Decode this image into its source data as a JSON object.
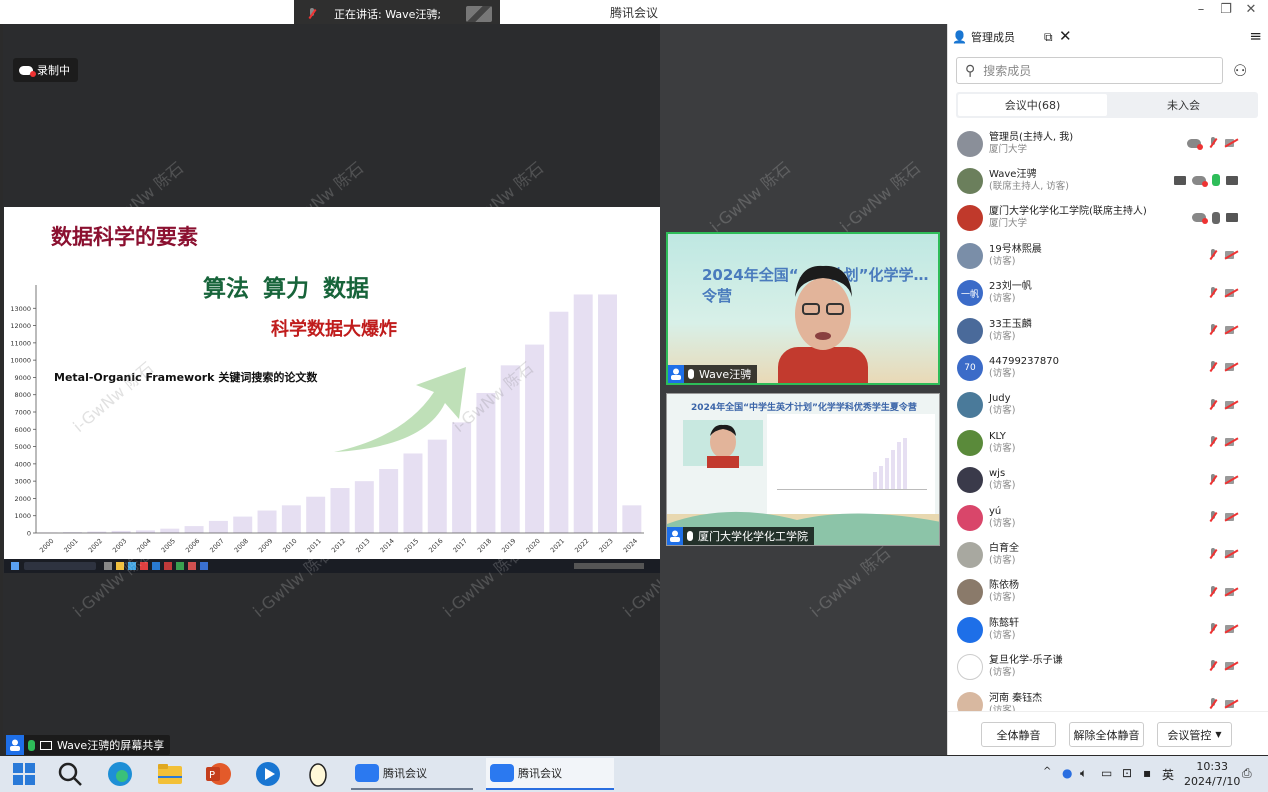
{
  "window": {
    "title": "腾讯会议"
  },
  "speaking": {
    "label": "正在讲话:  Wave汪骋;"
  },
  "recording": {
    "label": "录制中"
  },
  "watermark": "i-GwNw 陈石",
  "slide": {
    "title": "数据科学的要素",
    "three_elements": "算法  算力  数据",
    "subtitle": "科学数据大爆炸",
    "chart_caption": "Metal-Organic Framework 关键词搜索的论文数"
  },
  "chart_data": {
    "type": "bar",
    "title": "Metal-Organic Framework 关键词搜索的论文数",
    "categories": [
      "2000",
      "2001",
      "2002",
      "2003",
      "2004",
      "2005",
      "2006",
      "2007",
      "2008",
      "2009",
      "2010",
      "2011",
      "2012",
      "2013",
      "2014",
      "2015",
      "2016",
      "2017",
      "2018",
      "2019",
      "2020",
      "2021",
      "2022",
      "2023",
      "2024"
    ],
    "values": [
      30,
      50,
      80,
      120,
      150,
      250,
      400,
      700,
      950,
      1300,
      1600,
      2100,
      2600,
      3000,
      3700,
      4600,
      5400,
      6400,
      8100,
      9700,
      10900,
      12800,
      13800,
      13800,
      1600
    ],
    "yticks": [
      0,
      1000,
      2000,
      3000,
      4000,
      5000,
      6000,
      7000,
      8000,
      9000,
      10000,
      11000,
      12000,
      13000
    ],
    "ylim": [
      0,
      14000
    ],
    "bar_color": "#e6dff2",
    "grid": false
  },
  "share": {
    "label": "Wave汪骋的屏幕共享"
  },
  "tiles": [
    {
      "label": "Wave汪骋",
      "banner": "2024年全国“…才计划”化学学…令营"
    },
    {
      "label": "厦门大学化学化工学院",
      "header": "2024年全国“中学生英才计划”化学学科优秀学生夏令营"
    }
  ],
  "panel": {
    "title": "管理成员",
    "search_placeholder": "搜索成员",
    "tab_in": "会议中(68)",
    "tab_out": "未入会",
    "members": [
      {
        "name": "管理员(主持人, 我)",
        "role": "厦门大学",
        "color": "#8a8f99",
        "icons": [
          "cloud",
          "mic-mute",
          "cam-mute"
        ]
      },
      {
        "name": "Wave汪骋",
        "role": "(联席主持人, 访客)",
        "color": "#6b7f5c",
        "icons": [
          "scr",
          "cloud",
          "mic-on",
          "cam-on"
        ]
      },
      {
        "name": "厦门大学化学化工学院(联席主持人)",
        "role": "厦门大学",
        "color": "#c0392b",
        "icons": [
          "cloud",
          "mic-grey",
          "cam-on"
        ]
      },
      {
        "name": "19号林熙晨",
        "role": "(访客)",
        "color": "#7a8ea8",
        "icons": [
          "mic-mute",
          "cam-mute"
        ]
      },
      {
        "name": "23刘一帆",
        "role": "(访客)",
        "color": "#3b6bc8",
        "initial": "一帆",
        "icons": [
          "mic-mute",
          "cam-mute"
        ]
      },
      {
        "name": "33王玉麟",
        "role": "(访客)",
        "color": "#4a6a9a",
        "icons": [
          "mic-mute",
          "cam-mute"
        ]
      },
      {
        "name": "44799237870",
        "role": "(访客)",
        "color": "#3b6bc8",
        "initial": "70",
        "icons": [
          "mic-mute",
          "cam-mute"
        ]
      },
      {
        "name": "Judy",
        "role": "(访客)",
        "color": "#4a7a9a",
        "icons": [
          "mic-mute",
          "cam-mute"
        ]
      },
      {
        "name": "KLY",
        "role": "(访客)",
        "color": "#5a8a3a",
        "icons": [
          "mic-mute",
          "cam-mute"
        ]
      },
      {
        "name": "wjs",
        "role": "(访客)",
        "color": "#3a3a4a",
        "icons": [
          "mic-mute",
          "cam-mute"
        ]
      },
      {
        "name": "yú",
        "role": "(访客)",
        "color": "#d9466a",
        "icons": [
          "mic-mute",
          "cam-mute"
        ]
      },
      {
        "name": "白育全",
        "role": "(访客)",
        "color": "#a8a8a0",
        "icons": [
          "mic-mute",
          "cam-mute"
        ]
      },
      {
        "name": "陈依杨",
        "role": "(访客)",
        "color": "#8a7a6a",
        "icons": [
          "mic-mute",
          "cam-mute"
        ]
      },
      {
        "name": "陈懿轩",
        "role": "(访客)",
        "color": "#1e6fe8",
        "icons": [
          "mic-mute",
          "cam-mute"
        ]
      },
      {
        "name": "复旦化学-乐子谦",
        "role": "(访客)",
        "color": "#ffffff",
        "icons": [
          "mic-mute",
          "cam-mute"
        ]
      },
      {
        "name": "河南 秦钰杰",
        "role": "(访客)",
        "color": "#d8b8a0",
        "icons": [
          "mic-mute",
          "cam-mute"
        ]
      }
    ],
    "btn_mute_all": "全体静音",
    "btn_unmute_all": "解除全体静音",
    "btn_control": "会议管控"
  },
  "taskbar": {
    "app1": "腾讯会议",
    "app2": "腾讯会议",
    "ime": "英",
    "time": "10:33",
    "date": "2024/7/10"
  }
}
